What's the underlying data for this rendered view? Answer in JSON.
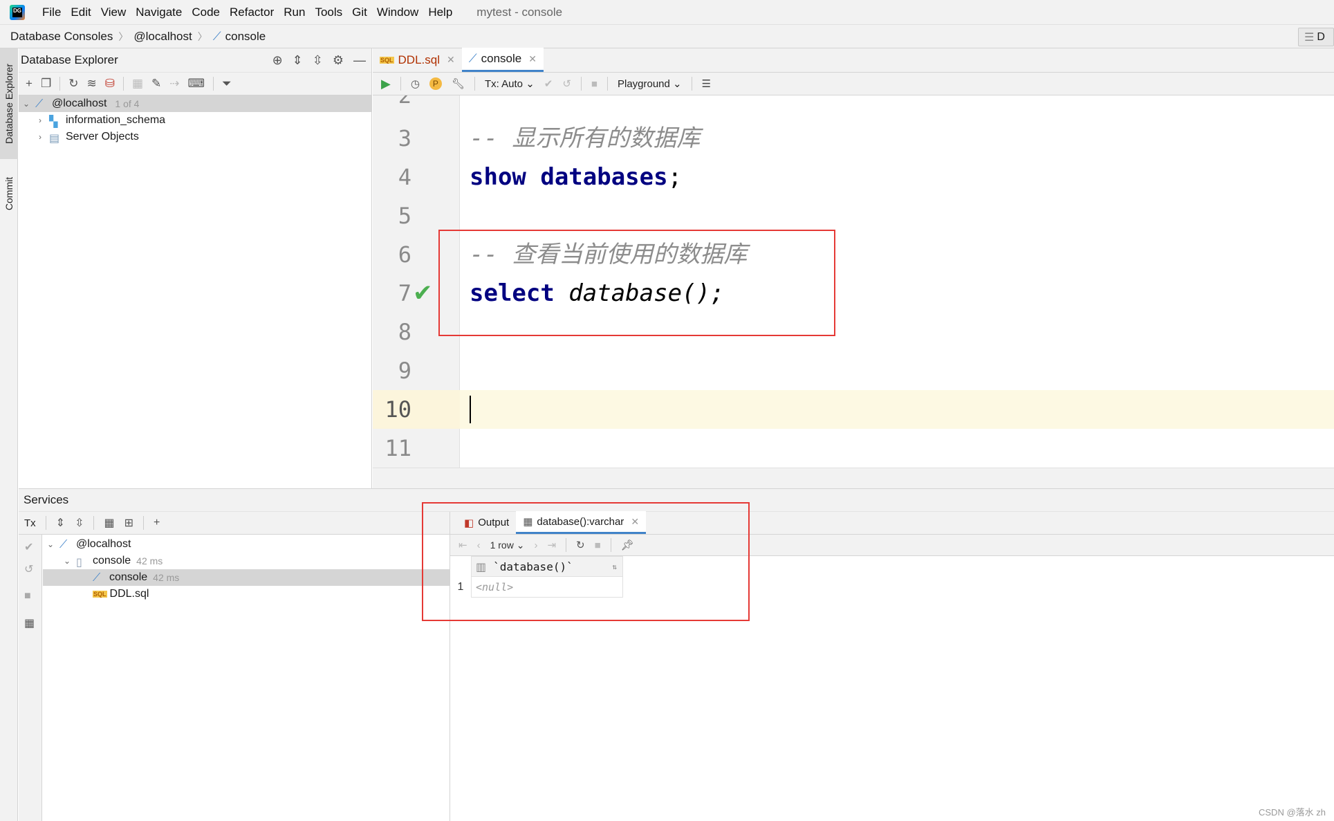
{
  "app": {
    "logo_text": "DG",
    "window_title": "mytest - console"
  },
  "menu": [
    {
      "label": "File"
    },
    {
      "label": "Edit"
    },
    {
      "label": "View"
    },
    {
      "label": "Navigate"
    },
    {
      "label": "Code"
    },
    {
      "label": "Refactor"
    },
    {
      "label": "Run"
    },
    {
      "label": "Tools"
    },
    {
      "label": "Git"
    },
    {
      "label": "Window"
    },
    {
      "label": "Help"
    }
  ],
  "breadcrumb": [
    "Database Consoles",
    "@localhost",
    "console"
  ],
  "breadcrumb_right": "D",
  "left_strip": {
    "db_explorer": "Database Explorer",
    "commit": "Commit"
  },
  "db_explorer": {
    "title": "Database Explorer",
    "tree": [
      {
        "label": "@localhost",
        "meta": "1 of 4",
        "expanded": true
      },
      {
        "label": "information_schema"
      },
      {
        "label": "Server Objects"
      }
    ]
  },
  "editor_tabs": [
    {
      "label": "DDL.sql",
      "badge": "SQL",
      "active": false
    },
    {
      "label": "console",
      "active": true
    }
  ],
  "editor_toolbar": {
    "tx_mode": "Tx: Auto",
    "mode": "Playground",
    "p_badge": "P"
  },
  "code_lines": [
    {
      "num": "2",
      "text": ""
    },
    {
      "num": "3",
      "text": "-- 显示所有的数据库",
      "type": "comment"
    },
    {
      "num": "4",
      "keyword": "show databases",
      "rest": ";"
    },
    {
      "num": "5",
      "text": ""
    },
    {
      "num": "6",
      "text": "-- 查看当前使用的数据库",
      "type": "comment"
    },
    {
      "num": "7",
      "keyword": "select",
      "rest": " database();",
      "executed": true
    },
    {
      "num": "8",
      "text": ""
    },
    {
      "num": "9",
      "text": ""
    },
    {
      "num": "10",
      "text": "",
      "current": true
    },
    {
      "num": "11",
      "text": ""
    }
  ],
  "services": {
    "title": "Services",
    "tx_label": "Tx",
    "tree": [
      {
        "label": "@localhost"
      },
      {
        "label": "console",
        "meta": "42 ms"
      },
      {
        "label": "console",
        "meta": "42 ms",
        "selected": true
      },
      {
        "label": "DDL.sql",
        "badge": "SQL"
      }
    ],
    "result_tabs": [
      {
        "label": "Output"
      },
      {
        "label": "database():varchar",
        "active": true
      }
    ],
    "row_count": "1 row",
    "grid": {
      "columns": [
        "`database()`"
      ],
      "rows": [
        {
          "num": "1",
          "values": [
            "<null>"
          ]
        }
      ]
    }
  },
  "watermark": "CSDN @落水 zh",
  "colors": {
    "accent": "#4083c9",
    "annotation": "#e53935",
    "keyword": "#000080",
    "success": "#4caf50"
  }
}
